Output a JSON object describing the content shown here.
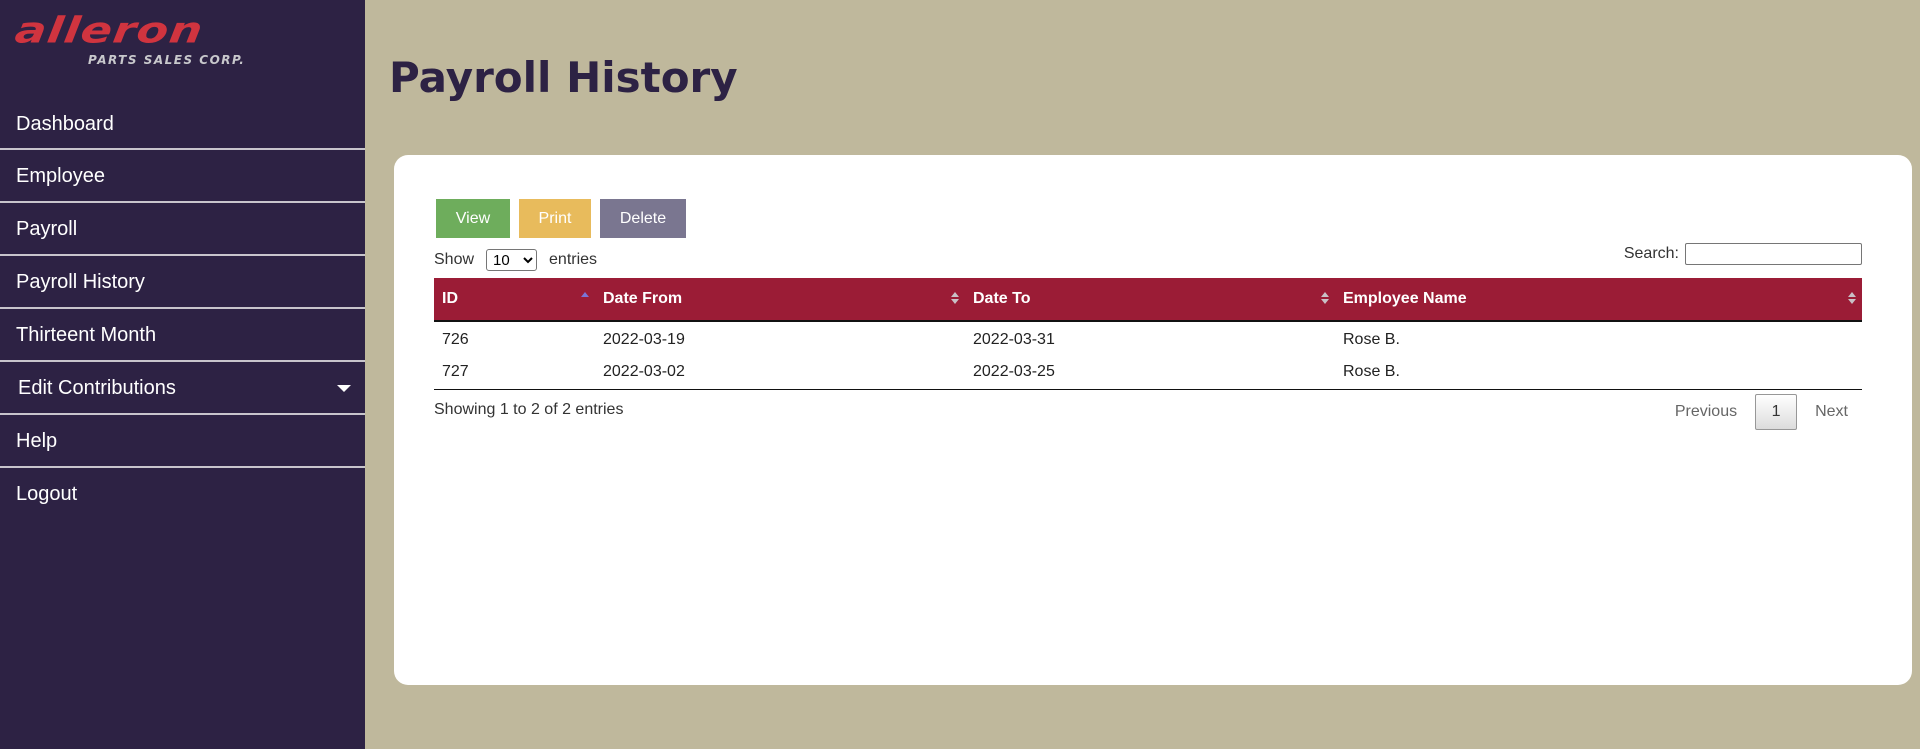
{
  "brand": {
    "name": "alleron",
    "tagline": "PARTS SALES CORP."
  },
  "sidebar": {
    "items": [
      {
        "label": "Dashboard"
      },
      {
        "label": "Employee"
      },
      {
        "label": "Payroll"
      },
      {
        "label": "Payroll History"
      },
      {
        "label": "Thirteent Month"
      },
      {
        "label": "Edit Contributions",
        "has_dropdown": true
      },
      {
        "label": "Help"
      },
      {
        "label": "Logout"
      }
    ]
  },
  "page": {
    "title": "Payroll History"
  },
  "toolbar": {
    "view_label": "View",
    "print_label": "Print",
    "delete_label": "Delete"
  },
  "length_control": {
    "prefix": "Show",
    "selected": "10",
    "options": [
      "10"
    ],
    "suffix": "entries"
  },
  "search": {
    "label": "Search:",
    "value": "",
    "placeholder": ""
  },
  "table": {
    "columns": [
      {
        "label": "ID",
        "sort": "asc"
      },
      {
        "label": "Date From",
        "sort": "none"
      },
      {
        "label": "Date To",
        "sort": "none"
      },
      {
        "label": "Employee Name",
        "sort": "none"
      }
    ],
    "rows": [
      {
        "id": "726",
        "date_from": "2022-03-19",
        "date_to": "2022-03-31",
        "employee_name": "Rose B."
      },
      {
        "id": "727",
        "date_from": "2022-03-02",
        "date_to": "2022-03-25",
        "employee_name": "Rose B."
      }
    ]
  },
  "footer": {
    "info": "Showing 1 to 2 of 2 entries",
    "previous_label": "Previous",
    "current_page": "1",
    "next_label": "Next"
  },
  "colors": {
    "sidebar_bg": "#2d2244",
    "page_bg": "#bfb89c",
    "brand_red": "#d0343f",
    "table_header": "#9b1c36",
    "view_btn": "#6ead5c",
    "print_btn": "#e8bb5c",
    "delete_btn": "#7a7690"
  }
}
